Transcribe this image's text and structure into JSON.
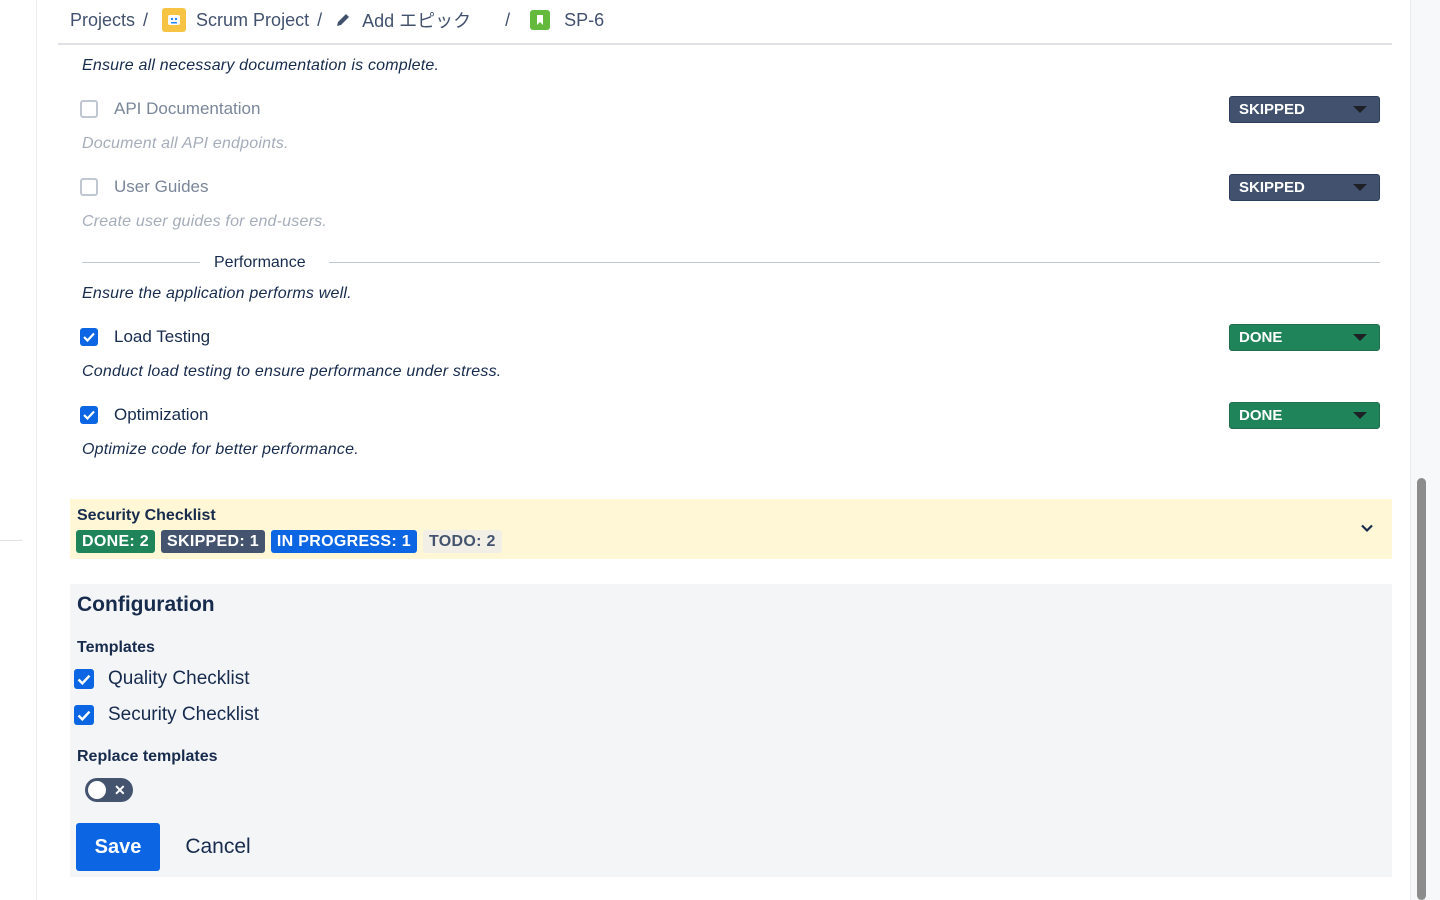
{
  "breadcrumb": {
    "projects": "Projects",
    "project": "Scrum Project",
    "epic": "Add エピック",
    "issue": "SP-6",
    "separator": "/"
  },
  "quality": {
    "docs_description": "Ensure all necessary documentation is complete.",
    "items": [
      {
        "label": "API Documentation",
        "checked": false,
        "status": "SKIPPED",
        "description": "Document all API endpoints."
      },
      {
        "label": "User Guides",
        "checked": false,
        "status": "SKIPPED",
        "description": "Create user guides for end-users."
      },
      {
        "label": "Load Testing",
        "checked": true,
        "status": "DONE",
        "description": "Conduct load testing to ensure performance under stress."
      },
      {
        "label": "Optimization",
        "checked": true,
        "status": "DONE",
        "description": "Optimize code for better performance."
      }
    ],
    "performance_heading": "Performance",
    "performance_description": "Ensure the application performs well."
  },
  "security": {
    "title": "Security Checklist",
    "badges": {
      "done": "DONE: 2",
      "skipped": "SKIPPED: 1",
      "in_progress": "IN PROGRESS: 1",
      "todo": "TODO: 2"
    },
    "expanded": false
  },
  "configuration": {
    "title": "Configuration",
    "templates_label": "Templates",
    "templates": [
      {
        "label": "Quality Checklist",
        "checked": true
      },
      {
        "label": "Security Checklist",
        "checked": true
      }
    ],
    "replace_label": "Replace templates",
    "replace_enabled": false,
    "save_label": "Save",
    "cancel_label": "Cancel"
  },
  "colors": {
    "accent": "#0c66e4",
    "done": "#1f845a",
    "skipped": "#42526e",
    "security_panel": "#fff7d6"
  }
}
